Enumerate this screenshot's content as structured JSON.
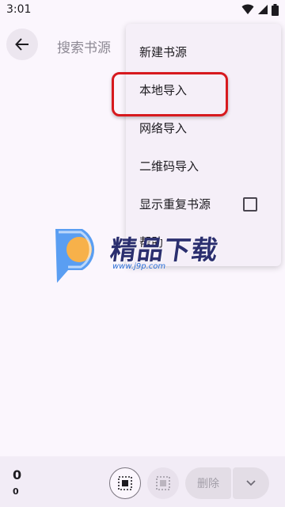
{
  "status_bar": {
    "time": "3:01",
    "icons": [
      "wifi-icon",
      "signal-icon",
      "battery-icon"
    ]
  },
  "topbar": {
    "back_icon": "arrow-left-icon",
    "search_placeholder": "搜索书源"
  },
  "menu": {
    "items": [
      {
        "label": "新建书源"
      },
      {
        "label": "本地导入",
        "highlighted": true
      },
      {
        "label": "网络导入"
      },
      {
        "label": "二维码导入"
      },
      {
        "label": "显示重复书源",
        "checkbox": false
      },
      {
        "label": "帮助"
      }
    ]
  },
  "watermark": {
    "title": "精品下载",
    "url": "www.j9p.com"
  },
  "bottom_bar": {
    "count_primary": "0",
    "count_secondary": "0",
    "select_all_icon": "select-all-icon",
    "invert_selection_icon": "invert-selection-icon",
    "delete_label": "删除",
    "more_icon": "chevron-down-icon"
  },
  "colors": {
    "background": "#fbf6fd",
    "menu_background": "#f5eff8",
    "highlight_border": "#d7191e",
    "bottom_bar": "#f2ecf6"
  }
}
